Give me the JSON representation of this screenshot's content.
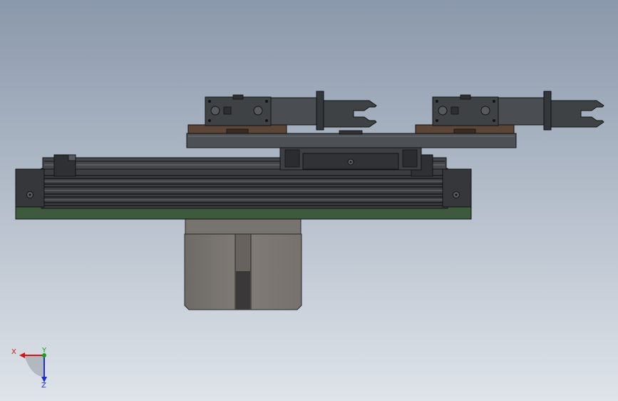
{
  "viewport": {
    "background_top": "#8a98ab",
    "background_bottom": "#dfe4ea"
  },
  "model": {
    "colors": {
      "body_dark": "#3b3d40",
      "body_mid": "#56595d",
      "body_light": "#6c7075",
      "edge": "#121314",
      "base_green": "#3e5a3c",
      "bracket_brown": "#5a4536",
      "motor_gray": "#7b7671",
      "motor_shadow": "#3a3838"
    }
  },
  "triad": {
    "x_label": "X",
    "y_label": "Y",
    "z_label": "Z",
    "x_color": "#d01818",
    "y_color": "#12a412",
    "z_color": "#1b2fd0"
  }
}
